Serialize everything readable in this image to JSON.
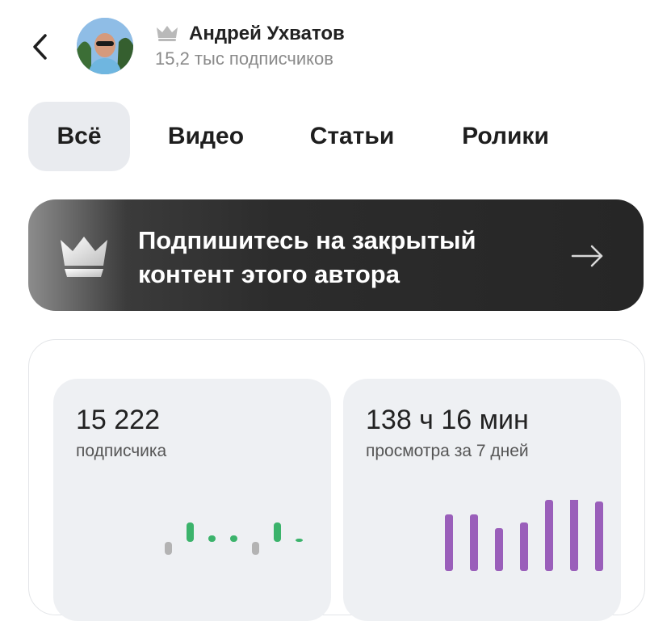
{
  "header": {
    "back_icon": "chevron-left-icon",
    "author_name": "Андрей Ухватов",
    "subscribers": "15,2 тыс подписчиков",
    "crown_icon": "crown-icon"
  },
  "tabs": [
    {
      "label": "Всё",
      "active": true
    },
    {
      "label": "Видео",
      "active": false
    },
    {
      "label": "Статьи",
      "active": false
    },
    {
      "label": "Ролики",
      "active": false
    }
  ],
  "banner": {
    "text": "Подпишитесь на закрытый контент этого автора",
    "arrow_icon": "arrow-right-icon"
  },
  "stats": {
    "subscribers": {
      "value": "15 222",
      "label": "подписчика",
      "chart_data": {
        "type": "bar",
        "colors": {
          "up": "#3bb36b",
          "down": "#b3b3b3"
        },
        "changes": [
          -2,
          3,
          1,
          1,
          -2,
          3,
          0.5
        ]
      }
    },
    "views": {
      "value": "138 ч 16 мин",
      "label": "просмотра за 7 дней",
      "chart_data": {
        "type": "bar",
        "color": "#9a5fba",
        "values": [
          70,
          70,
          53,
          60,
          88,
          100,
          86
        ]
      }
    }
  }
}
